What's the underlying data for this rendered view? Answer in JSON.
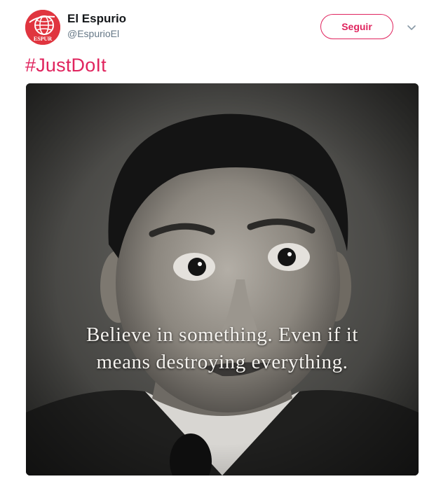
{
  "tweet": {
    "author": {
      "display_name": "El Espurio",
      "handle": "@EspurioEl",
      "avatar_icon": "globe-logo-icon",
      "avatar_text": "ESPUR"
    },
    "follow_label": "Seguir",
    "menu_icon": "chevron-down-icon",
    "text": "#JustDoIt",
    "media": {
      "overlay_line_1": "Believe in something. Even if it",
      "overlay_line_2": "means destroying everything."
    }
  },
  "colors": {
    "accent": "#e0245e",
    "avatar_bg": "#e0353f",
    "name": "#14171a",
    "handle": "#657786"
  }
}
